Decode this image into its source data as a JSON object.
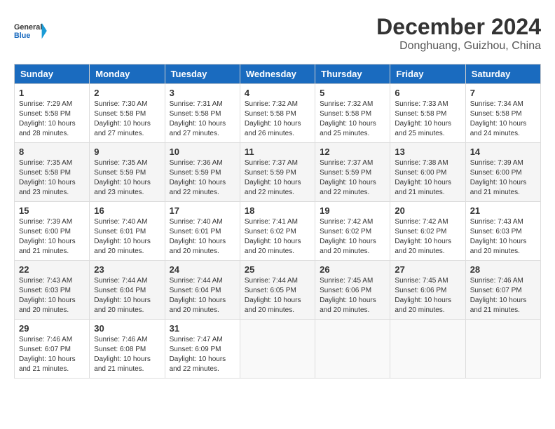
{
  "header": {
    "logo_line1": "General",
    "logo_line2": "Blue",
    "month_title": "December 2024",
    "location": "Donghuang, Guizhou, China"
  },
  "weekdays": [
    "Sunday",
    "Monday",
    "Tuesday",
    "Wednesday",
    "Thursday",
    "Friday",
    "Saturday"
  ],
  "weeks": [
    [
      {
        "day": "1",
        "sunrise": "7:29 AM",
        "sunset": "5:58 PM",
        "daylight": "10 hours and 28 minutes."
      },
      {
        "day": "2",
        "sunrise": "7:30 AM",
        "sunset": "5:58 PM",
        "daylight": "10 hours and 27 minutes."
      },
      {
        "day": "3",
        "sunrise": "7:31 AM",
        "sunset": "5:58 PM",
        "daylight": "10 hours and 27 minutes."
      },
      {
        "day": "4",
        "sunrise": "7:32 AM",
        "sunset": "5:58 PM",
        "daylight": "10 hours and 26 minutes."
      },
      {
        "day": "5",
        "sunrise": "7:32 AM",
        "sunset": "5:58 PM",
        "daylight": "10 hours and 25 minutes."
      },
      {
        "day": "6",
        "sunrise": "7:33 AM",
        "sunset": "5:58 PM",
        "daylight": "10 hours and 25 minutes."
      },
      {
        "day": "7",
        "sunrise": "7:34 AM",
        "sunset": "5:58 PM",
        "daylight": "10 hours and 24 minutes."
      }
    ],
    [
      {
        "day": "8",
        "sunrise": "7:35 AM",
        "sunset": "5:58 PM",
        "daylight": "10 hours and 23 minutes."
      },
      {
        "day": "9",
        "sunrise": "7:35 AM",
        "sunset": "5:59 PM",
        "daylight": "10 hours and 23 minutes."
      },
      {
        "day": "10",
        "sunrise": "7:36 AM",
        "sunset": "5:59 PM",
        "daylight": "10 hours and 22 minutes."
      },
      {
        "day": "11",
        "sunrise": "7:37 AM",
        "sunset": "5:59 PM",
        "daylight": "10 hours and 22 minutes."
      },
      {
        "day": "12",
        "sunrise": "7:37 AM",
        "sunset": "5:59 PM",
        "daylight": "10 hours and 22 minutes."
      },
      {
        "day": "13",
        "sunrise": "7:38 AM",
        "sunset": "6:00 PM",
        "daylight": "10 hours and 21 minutes."
      },
      {
        "day": "14",
        "sunrise": "7:39 AM",
        "sunset": "6:00 PM",
        "daylight": "10 hours and 21 minutes."
      }
    ],
    [
      {
        "day": "15",
        "sunrise": "7:39 AM",
        "sunset": "6:00 PM",
        "daylight": "10 hours and 21 minutes."
      },
      {
        "day": "16",
        "sunrise": "7:40 AM",
        "sunset": "6:01 PM",
        "daylight": "10 hours and 20 minutes."
      },
      {
        "day": "17",
        "sunrise": "7:40 AM",
        "sunset": "6:01 PM",
        "daylight": "10 hours and 20 minutes."
      },
      {
        "day": "18",
        "sunrise": "7:41 AM",
        "sunset": "6:02 PM",
        "daylight": "10 hours and 20 minutes."
      },
      {
        "day": "19",
        "sunrise": "7:42 AM",
        "sunset": "6:02 PM",
        "daylight": "10 hours and 20 minutes."
      },
      {
        "day": "20",
        "sunrise": "7:42 AM",
        "sunset": "6:02 PM",
        "daylight": "10 hours and 20 minutes."
      },
      {
        "day": "21",
        "sunrise": "7:43 AM",
        "sunset": "6:03 PM",
        "daylight": "10 hours and 20 minutes."
      }
    ],
    [
      {
        "day": "22",
        "sunrise": "7:43 AM",
        "sunset": "6:03 PM",
        "daylight": "10 hours and 20 minutes."
      },
      {
        "day": "23",
        "sunrise": "7:44 AM",
        "sunset": "6:04 PM",
        "daylight": "10 hours and 20 minutes."
      },
      {
        "day": "24",
        "sunrise": "7:44 AM",
        "sunset": "6:04 PM",
        "daylight": "10 hours and 20 minutes."
      },
      {
        "day": "25",
        "sunrise": "7:44 AM",
        "sunset": "6:05 PM",
        "daylight": "10 hours and 20 minutes."
      },
      {
        "day": "26",
        "sunrise": "7:45 AM",
        "sunset": "6:06 PM",
        "daylight": "10 hours and 20 minutes."
      },
      {
        "day": "27",
        "sunrise": "7:45 AM",
        "sunset": "6:06 PM",
        "daylight": "10 hours and 20 minutes."
      },
      {
        "day": "28",
        "sunrise": "7:46 AM",
        "sunset": "6:07 PM",
        "daylight": "10 hours and 21 minutes."
      }
    ],
    [
      {
        "day": "29",
        "sunrise": "7:46 AM",
        "sunset": "6:07 PM",
        "daylight": "10 hours and 21 minutes."
      },
      {
        "day": "30",
        "sunrise": "7:46 AM",
        "sunset": "6:08 PM",
        "daylight": "10 hours and 21 minutes."
      },
      {
        "day": "31",
        "sunrise": "7:47 AM",
        "sunset": "6:09 PM",
        "daylight": "10 hours and 22 minutes."
      },
      null,
      null,
      null,
      null
    ]
  ]
}
